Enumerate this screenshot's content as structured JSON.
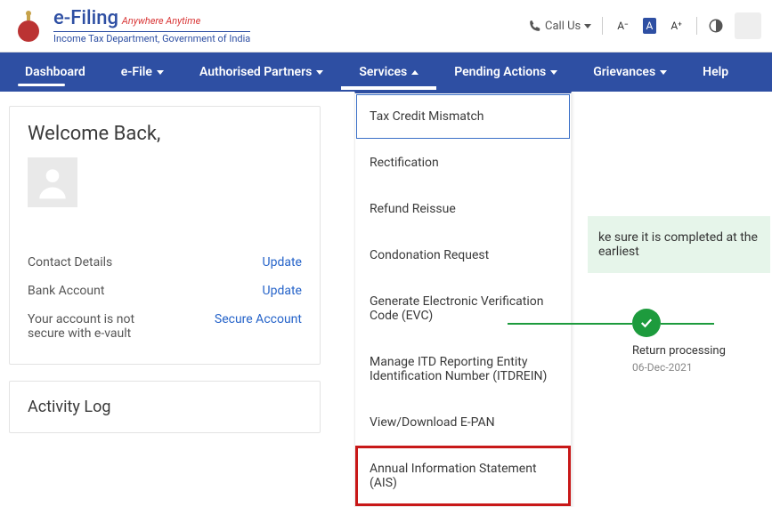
{
  "header": {
    "brand_title": "e-Filing",
    "brand_tagline": "Anywhere Anytime",
    "brand_subtitle": "Income Tax Department, Government of India",
    "call_us": "Call Us",
    "font_small": "A⁻",
    "font_normal": "A",
    "font_large": "A⁺"
  },
  "nav": {
    "dashboard": "Dashboard",
    "efile": "e-File",
    "partners": "Authorised Partners",
    "services": "Services",
    "pending": "Pending Actions",
    "grievances": "Grievances",
    "help": "Help"
  },
  "welcome": {
    "title": "Welcome Back,",
    "contact_label": "Contact Details",
    "contact_action": "Update",
    "bank_label": "Bank Account",
    "bank_action": "Update",
    "secure_label": "Your account is not secure with e-vault",
    "secure_action": "Secure Account"
  },
  "activity": {
    "title": "Activity Log"
  },
  "dropdown": {
    "items": [
      "Tax Credit Mismatch",
      "Rectification",
      "Refund Reissue",
      "Condonation Request",
      "Generate Electronic Verification Code (EVC)",
      "Manage ITD Reporting Entity Identification Number (ITDREIN)",
      "View/Download E-PAN",
      "Annual Information Statement (AIS)"
    ]
  },
  "right": {
    "banner_text": "ke sure it is completed at the earliest",
    "status_label": "Return processing",
    "status_date": "06-Dec-2021"
  }
}
